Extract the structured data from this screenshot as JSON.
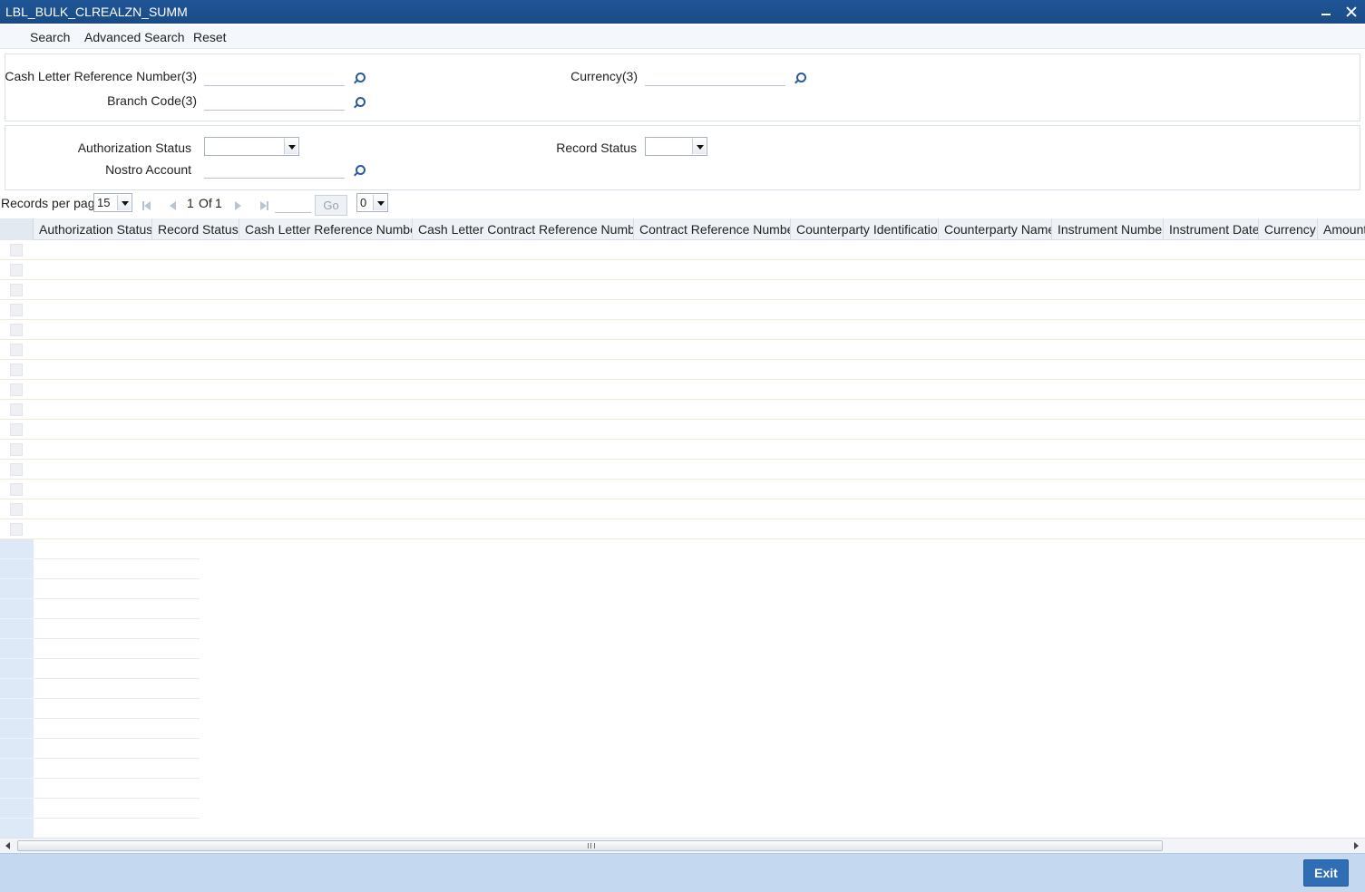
{
  "window": {
    "title": "LBL_BULK_CLREALZN_SUMM"
  },
  "toolbar": {
    "search": "Search",
    "advanced_search": "Advanced Search",
    "reset": "Reset"
  },
  "criteria": {
    "cash_letter_ref_label": "Cash Letter Reference Number(3)",
    "currency_label": "Currency(3)",
    "branch_code_label": "Branch Code(3)",
    "authorization_status_label": "Authorization Status",
    "record_status_label": "Record Status",
    "nostro_account_label": "Nostro Account",
    "cash_letter_ref_value": "",
    "currency_value": "",
    "branch_code_value": "",
    "nostro_account_value": "",
    "authorization_status_value": "",
    "record_status_value": ""
  },
  "pager": {
    "records_per_page_label": "Records per page",
    "records_per_page_value": "15",
    "page_current": "1",
    "page_of_label": "Of",
    "page_total": "1",
    "goto_value": "",
    "go_label": "Go",
    "column_select_value": "0"
  },
  "grid": {
    "columns": [
      "Authorization Status",
      "Record Status",
      "Cash Letter Reference Number",
      "Cash Letter Contract Reference Number",
      "Contract Reference Number",
      "Counterparty Identification",
      "Counterparty Name",
      "Instrument Number",
      "Instrument Date",
      "Currency",
      "Amount"
    ],
    "rows_visible": 15
  },
  "footer": {
    "exit_label": "Exit"
  }
}
